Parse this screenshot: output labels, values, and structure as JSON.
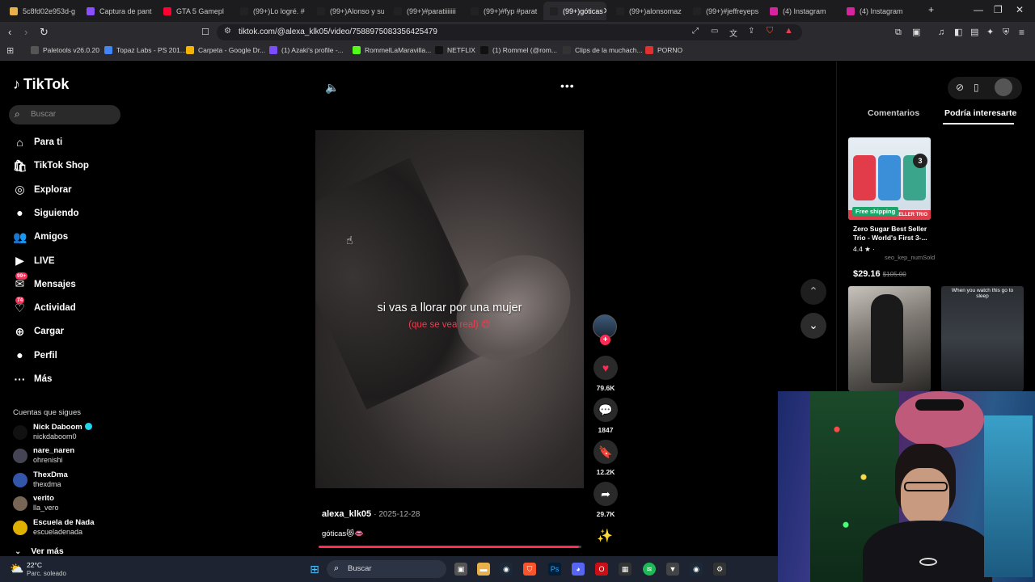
{
  "browser": {
    "tabs": [
      {
        "title": "5c8fd02e953d-g",
        "color": "#e8b04a"
      },
      {
        "title": "Captura de pant",
        "color": "#8a4fff"
      },
      {
        "title": "GTA 5 Gamepl",
        "color": "#ff0033"
      },
      {
        "title": "(99+)Lo logré. #",
        "color": "#222"
      },
      {
        "title": "(99+)Alonso y su",
        "color": "#222"
      },
      {
        "title": "(99+)#paratiiiiiii",
        "color": "#222"
      },
      {
        "title": "(99+)#fyp #parat",
        "color": "#222"
      },
      {
        "title": "(99+)góticas",
        "color": "#222"
      },
      {
        "title": "(99+)alonsomaz",
        "color": "#222"
      },
      {
        "title": "(99+)#jeffreyeps",
        "color": "#222"
      },
      {
        "title": "(4) Instagram",
        "color": "#d6249f"
      },
      {
        "title": "(4) Instagram",
        "color": "#d6249f"
      }
    ],
    "url": "tiktok.com/@alexa_klk05/video/7588975083356425479",
    "bookmarks": [
      {
        "label": "Paletools v26.0.20",
        "color": "#555"
      },
      {
        "label": "Topaz Labs - PS 201...",
        "color": "#4285f4"
      },
      {
        "label": "Carpeta - Google Dr...",
        "color": "#f4b400"
      },
      {
        "label": "(1) Azaki's profile -...",
        "color": "#7c4dff"
      },
      {
        "label": "RommelLaMaravilla...",
        "color": "#53fc18"
      },
      {
        "label": "NETFLIX",
        "color": "#111"
      },
      {
        "label": "(1) Rommel (@rom...",
        "color": "#111"
      },
      {
        "label": "Clips de la muchach...",
        "color": "#333"
      },
      {
        "label": "PORNO",
        "color": "#e03030"
      }
    ]
  },
  "sidebar": {
    "logo": "TikTok",
    "search_placeholder": "Buscar",
    "nav": [
      {
        "label": "Para ti",
        "icon": "home-icon"
      },
      {
        "label": "TikTok Shop",
        "icon": "shop-icon"
      },
      {
        "label": "Explorar",
        "icon": "compass-icon"
      },
      {
        "label": "Siguiendo",
        "icon": "following-avatar"
      },
      {
        "label": "Amigos",
        "icon": "friends-icon"
      },
      {
        "label": "LIVE",
        "icon": "live-icon"
      },
      {
        "label": "Mensajes",
        "icon": "messages-icon",
        "badge": "99+"
      },
      {
        "label": "Actividad",
        "icon": "activity-icon",
        "badge": "74"
      },
      {
        "label": "Cargar",
        "icon": "upload-icon"
      },
      {
        "label": "Perfil",
        "icon": "profile-avatar"
      },
      {
        "label": "Más",
        "icon": "more-icon"
      }
    ],
    "following_title": "Cuentas que sigues",
    "following": [
      {
        "name": "Nick Daboom",
        "handle": "nickdaboom0",
        "verified": true,
        "color": "#111"
      },
      {
        "name": "nare_naren",
        "handle": "ohrenishi",
        "verified": false,
        "color": "#445"
      },
      {
        "name": "ThexDma",
        "handle": "thexdma",
        "verified": false,
        "color": "#3355aa"
      },
      {
        "name": "verito",
        "handle": "lla_vero",
        "verified": false,
        "color": "#776655"
      },
      {
        "name": "Escuela de Nada",
        "handle": "escueladenada",
        "verified": false,
        "color": "#e0b000"
      }
    ],
    "see_more": "Ver más"
  },
  "video": {
    "caption_main": "si vas a llorar por una mujer",
    "caption_sub": "(que se vea real) 😍",
    "author": "alexa_klk05",
    "date": "2025-12-28",
    "description": "góticas😻👄",
    "progress": 0.99
  },
  "actions": {
    "likes": "79.6K",
    "comments": "1847",
    "saves": "12.2K",
    "shares": "29.7K"
  },
  "right_panel": {
    "tabs": [
      "Comentarios",
      "Podría interesarte"
    ],
    "active_tab": "Podría interesarte",
    "product": {
      "badge": "Free shipping",
      "banner": "SELLER TRIO",
      "pack": "3",
      "title": "Zero Sugar Best Seller Trio - World's First 3-...",
      "rating": "4.4 ★ ·",
      "sold": "seo_kep_numSold",
      "price": "29.16",
      "old_price": "$105.00"
    },
    "thumb_caption": "When you watch this go to sleep"
  },
  "taskbar": {
    "temp": "22°C",
    "weather": "Parc. soleado",
    "search_placeholder": "Buscar"
  },
  "colors": {
    "accent": "#fe2c55",
    "bg": "#000000",
    "chrome": "#2b2b2f"
  }
}
